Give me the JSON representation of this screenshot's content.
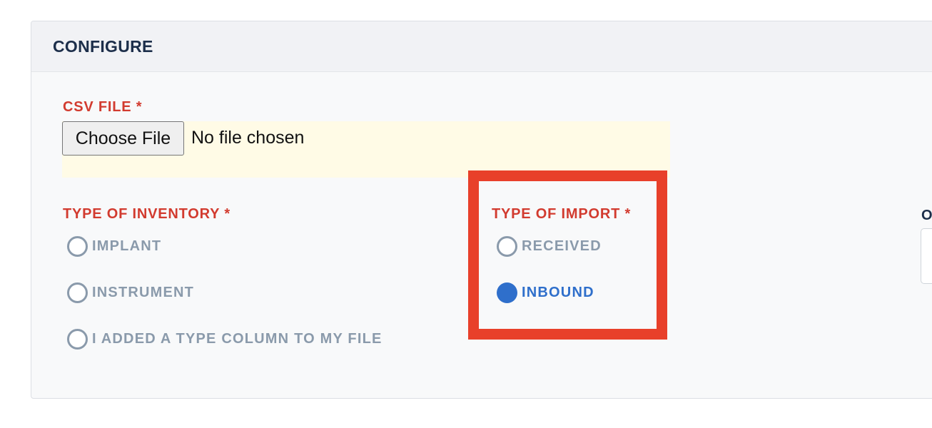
{
  "panel": {
    "title": "CONFIGURE"
  },
  "csv": {
    "label": "CSV FILE",
    "required_mark": "*",
    "button_label": "Choose File",
    "status": "No file chosen"
  },
  "inventory": {
    "label": "TYPE OF INVENTORY",
    "required_mark": "*",
    "options": [
      {
        "label": "IMPLANT",
        "checked": false
      },
      {
        "label": "INSTRUMENT",
        "checked": false
      },
      {
        "label": "I ADDED A TYPE COLUMN TO MY FILE",
        "checked": false
      }
    ]
  },
  "import": {
    "label": "TYPE OF IMPORT",
    "required_mark": "*",
    "options": [
      {
        "label": "RECEIVED",
        "checked": false
      },
      {
        "label": "INBOUND",
        "checked": true
      }
    ]
  },
  "third_column": {
    "label_fragment": "O"
  },
  "colors": {
    "required_red": "#d23b2f",
    "radio_selected": "#2f6fcb",
    "radio_unselected": "#8a9aab",
    "highlight": "#e8402a",
    "file_zone": "#fffbe6"
  }
}
